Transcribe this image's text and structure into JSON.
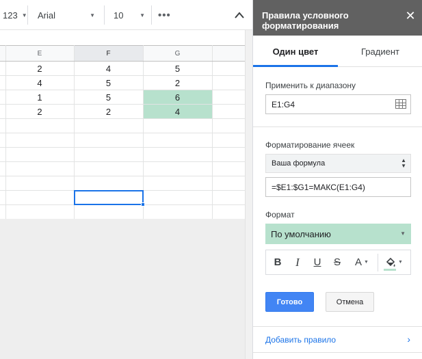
{
  "toolbar": {
    "number_format": "123",
    "font_name": "Arial",
    "font_size": "10",
    "more_label": "•••",
    "collapse_glyph": "∧"
  },
  "grid": {
    "columns": [
      "E",
      "F",
      "G"
    ],
    "rows": [
      [
        "2",
        "4",
        "5"
      ],
      [
        "4",
        "5",
        "2"
      ],
      [
        "1",
        "5",
        "6"
      ],
      [
        "2",
        "2",
        "4"
      ],
      [
        "",
        "",
        ""
      ],
      [
        "",
        "",
        ""
      ],
      [
        "",
        "",
        ""
      ],
      [
        "",
        "",
        ""
      ],
      [
        "",
        "",
        ""
      ],
      [
        "",
        "",
        ""
      ],
      [
        "",
        "",
        ""
      ]
    ],
    "highlighted_cells": [
      "G3",
      "G4"
    ],
    "highlight_color": "#b7e1cd",
    "selected_column": "F"
  },
  "panel": {
    "title": "Правила условного форматирования",
    "close_glyph": "✕",
    "tabs": [
      {
        "label": "Один цвет",
        "active": true
      },
      {
        "label": "Градиент",
        "active": false
      }
    ],
    "apply_range_label": "Применить к диапазону",
    "range_value": "E1:G4",
    "cell_format_label": "Форматирование ячеек",
    "condition_value": "Ваша формула",
    "formula_value": "=$E1:$G1=МАКС(E1:G4)",
    "format_label": "Формат",
    "format_preset": "По умолчанию",
    "format_buttons": {
      "bold": "B",
      "italic": "I",
      "underline": "U",
      "strikethrough": "S",
      "text_color": "A"
    },
    "done_label": "Готово",
    "cancel_label": "Отмена",
    "add_rule_label": "Добавить правило",
    "accent_color": "#1a73e8",
    "primary_button_color": "#4285f4"
  }
}
